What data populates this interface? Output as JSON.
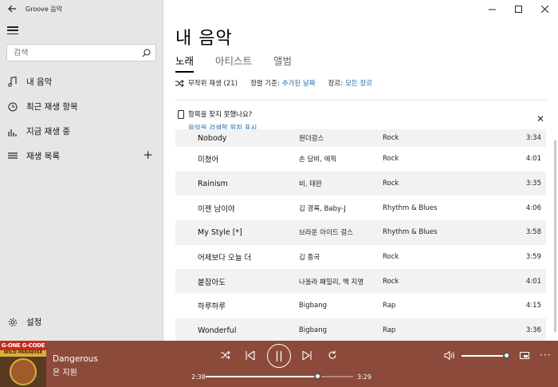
{
  "app": {
    "title": "Groove 음악"
  },
  "sidebar": {
    "search_placeholder": "검색",
    "items": [
      {
        "label": "내 음악",
        "icon": "music-note-icon"
      },
      {
        "label": "최근 재생 항목",
        "icon": "clock-icon"
      },
      {
        "label": "지금 재생 중",
        "icon": "equalizer-icon"
      },
      {
        "label": "재생 목록",
        "icon": "playlist-icon",
        "action": "+"
      }
    ],
    "settings_label": "설정"
  },
  "main": {
    "title": "내 음악",
    "tabs": [
      {
        "label": "노래",
        "active": true
      },
      {
        "label": "아티스트",
        "active": false
      },
      {
        "label": "앨범",
        "active": false
      }
    ],
    "toolbar": {
      "shuffle_label": "무작위 재생 (21)",
      "sort_label": "정렬 기준:",
      "sort_value": "추가된 날짜",
      "genre_label": "장르:",
      "genre_value": "모든 장르"
    },
    "notice": {
      "title": "항목을 찾지 못했나요?",
      "link": "음악을 검색할 위치 표시"
    },
    "songs": [
      {
        "title": "Nobody",
        "artist": "원더걸스",
        "genre": "Rock",
        "duration": "3:34"
      },
      {
        "title": "미쳤어",
        "artist": "손 담비, 에픽",
        "genre": "Rock",
        "duration": "4:01"
      },
      {
        "title": "Rainism",
        "artist": "비, 태완",
        "genre": "Rock",
        "duration": "3:35"
      },
      {
        "title": "이젠 남이야",
        "artist": "김 경록, Baby-J",
        "genre": "Rhythm & Blues",
        "duration": "4:06"
      },
      {
        "title": "My Style [*]",
        "artist": "브라운 아이드 걸스",
        "genre": "Rhythm & Blues",
        "duration": "3:58"
      },
      {
        "title": "어제보다 오늘 더",
        "artist": "김 종국",
        "genre": "Rock",
        "duration": "3:59"
      },
      {
        "title": "붙잡아도",
        "artist": "나올라 패밀리, 백 지영",
        "genre": "Rock",
        "duration": "4:01"
      },
      {
        "title": "하루하루",
        "artist": "Bigbang",
        "genre": "Rap",
        "duration": "4:15"
      },
      {
        "title": "Wonderful",
        "artist": "Bigbang",
        "genre": "Rap",
        "duration": "3:36"
      }
    ]
  },
  "player": {
    "title": "Dangerous",
    "artist": "은 지원",
    "elapsed": "2:38",
    "total": "3:29",
    "progress": 0.76,
    "volume": 0.95,
    "album_art_text": "G-ONE G-CODE",
    "album_art_text2": "WILD PARADISE",
    "colors": {
      "player_bg": "#8c4a3a",
      "accent_link": "#1f65a8",
      "sidebar_bg": "#e6e6e6"
    }
  }
}
